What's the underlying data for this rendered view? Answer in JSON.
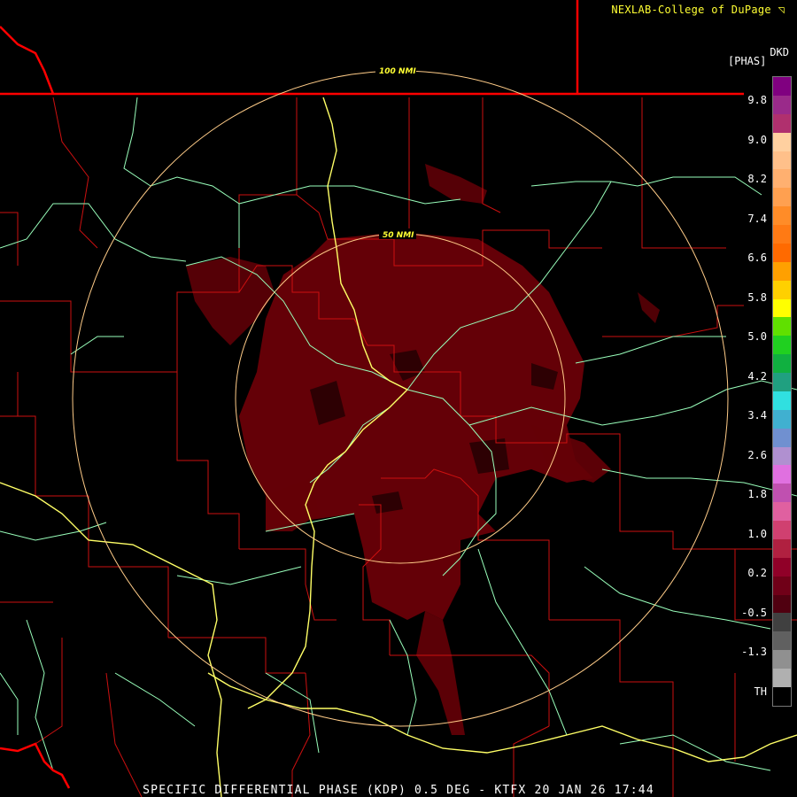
{
  "credit": "NEXLAB-College of DuPage ◹",
  "product": {
    "code": "DKD",
    "unit": "[PHAS]"
  },
  "caption": "SPECIFIC DIFFERENTIAL PHASE (KDP) 0.5 DEG - KTFX 20 JAN 26 17:44",
  "rings": [
    {
      "label": "100 NMI",
      "radius_nmi": 100
    },
    {
      "label": "50 NMI",
      "radius_nmi": 50
    }
  ],
  "legend": {
    "labels": [
      "9.8",
      "9.0",
      "8.2",
      "7.4",
      "6.6",
      "5.8",
      "5.0",
      "4.2",
      "3.4",
      "2.6",
      "1.8",
      "1.0",
      "0.2",
      "-0.5",
      "-1.3",
      "TH"
    ],
    "colors": [
      "#800080",
      "#9a2a8a",
      "#b0306e",
      "#ffd0a0",
      "#ffc08a",
      "#ffb070",
      "#ffa050",
      "#ff8c28",
      "#ff7a14",
      "#ff6a00",
      "#ffa000",
      "#ffd000",
      "#ffff00",
      "#60e000",
      "#20d020",
      "#10b040",
      "#20a080",
      "#30e0e0",
      "#40b0d0",
      "#7090d0",
      "#b090d0",
      "#e070e0",
      "#c050b0",
      "#e060a0",
      "#d04070",
      "#b02040",
      "#900028",
      "#700018",
      "#500010",
      "#404040",
      "#606060",
      "#909090",
      "#b0b0b0",
      "#000000"
    ]
  },
  "colors": {
    "state_border": "#ff0000",
    "county_line": "#cc1010",
    "highway": "#ffff66",
    "river": "#99ffbb",
    "ring": "#ffcc88",
    "echo": "#6a0008"
  }
}
